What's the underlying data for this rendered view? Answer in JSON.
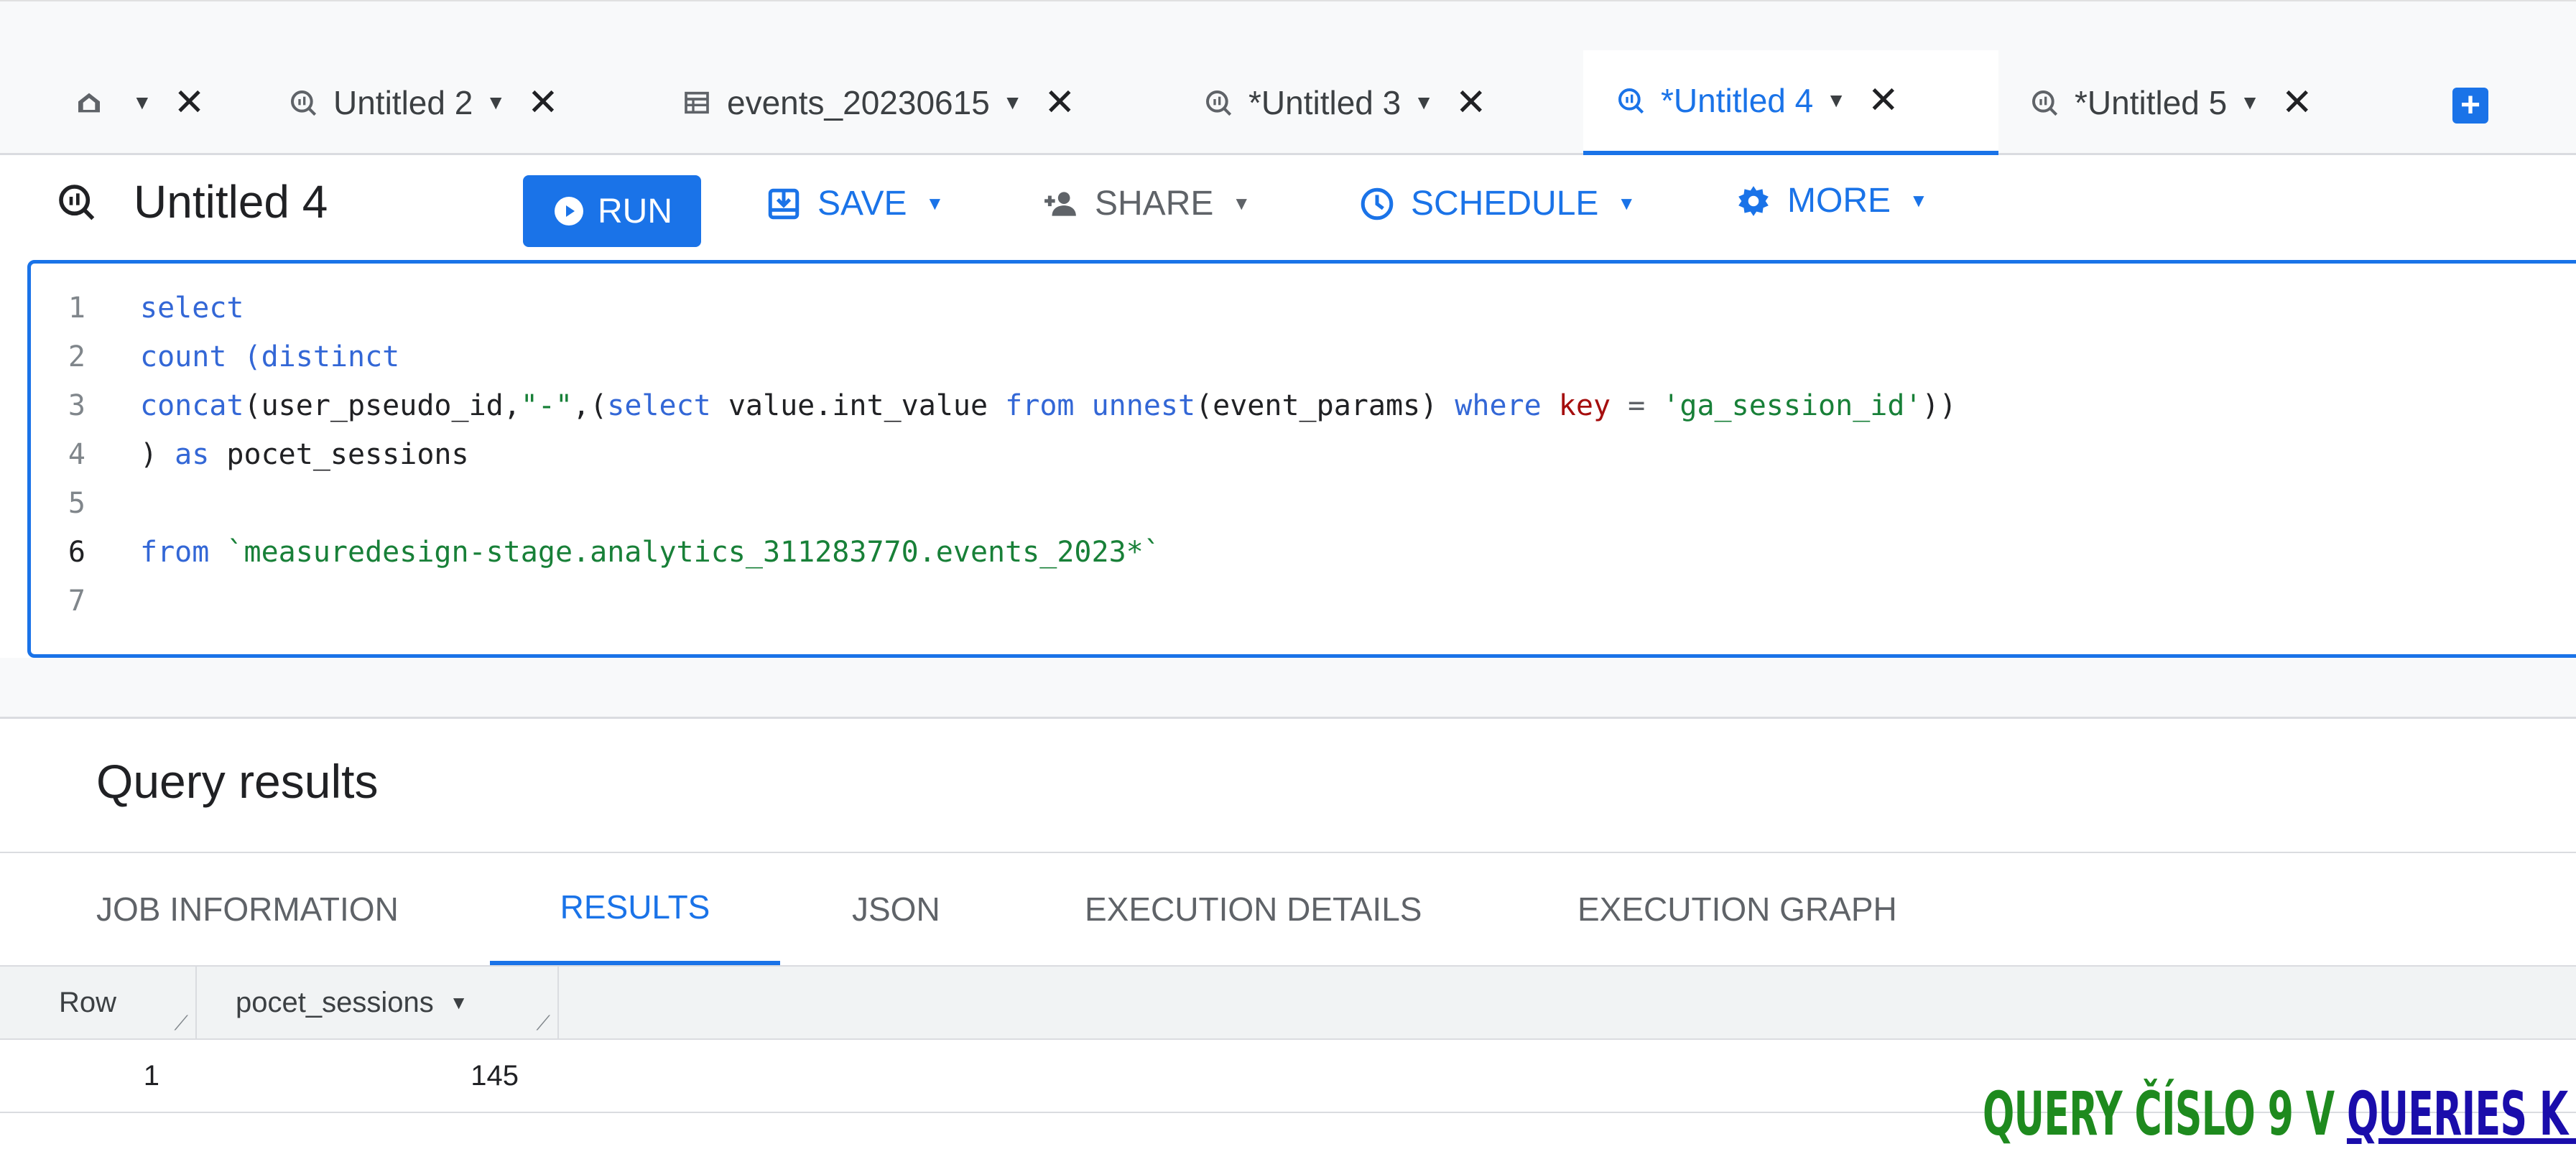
{
  "tabs": [
    {
      "label": "",
      "icon": "home-icon"
    },
    {
      "label": "Untitled 2",
      "icon": "query-icon"
    },
    {
      "label": "events_20230615",
      "icon": "table-icon"
    },
    {
      "label": "*Untitled 3",
      "icon": "query-icon"
    },
    {
      "label": "*Untitled 4",
      "icon": "query-icon",
      "active": true
    },
    {
      "label": "*Untitled 5",
      "icon": "query-icon"
    }
  ],
  "toolbar": {
    "title": "Untitled 4",
    "run": "RUN",
    "save": "SAVE",
    "share": "SHARE",
    "schedule": "SCHEDULE",
    "more": "MORE"
  },
  "editor": {
    "lines": [
      {
        "n": "1",
        "active": false
      },
      {
        "n": "2",
        "active": false
      },
      {
        "n": "3",
        "active": false
      },
      {
        "n": "4",
        "active": false
      },
      {
        "n": "5",
        "active": false
      },
      {
        "n": "6",
        "active": true
      },
      {
        "n": "7",
        "active": false
      }
    ],
    "code": {
      "l1_select": "select",
      "l2_count": "count (distinct",
      "l3_concat": "concat",
      "l3_open": "(",
      "l3_field": "user_pseudo_id,",
      "l3_dash": "\"-\"",
      "l3_comma": ",(",
      "l3_select": "select",
      "l3_value": " value.int_value ",
      "l3_from": "from",
      "l3_unnest": " unnest",
      "l3_params": "(event_params)",
      "l3_where": " where ",
      "l3_key": "key",
      "l3_eq": " = ",
      "l3_str": "'ga_session_id'",
      "l3_close": "))",
      "l4_paren": ") ",
      "l4_as": "as",
      "l4_alias": " pocet_sessions",
      "l6_from": "from",
      "l6_table": " `measuredesign-stage.analytics_311283770.events_2023*`"
    }
  },
  "results": {
    "title": "Query results",
    "tabs": [
      "JOB INFORMATION",
      "RESULTS",
      "JSON",
      "EXECUTION DETAILS",
      "EXECUTION GRAPH"
    ],
    "active_tab": "RESULTS",
    "columns": [
      "Row",
      "pocet_sessions"
    ],
    "rows": [
      [
        "1",
        "145"
      ]
    ]
  },
  "caption": {
    "text": "QUERY ČÍSLO 9 V ",
    "link": "QUERIES K P"
  },
  "colors": {
    "accent": "#1a73e8",
    "keyword": "#3367d6",
    "string": "#188038",
    "key": "#a50e0e",
    "caption": "#1e8a1e"
  }
}
